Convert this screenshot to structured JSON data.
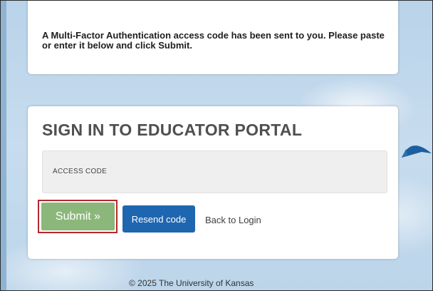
{
  "message": {
    "text_before": "A Multi-Factor Authentication access code has been sent to you. Please paste or enter it below and click ",
    "emphasis": "Submit",
    "text_after": "."
  },
  "signin": {
    "title": "SIGN IN TO EDUCATOR PORTAL",
    "access_code_label": "ACCESS CODE",
    "access_code_value": ""
  },
  "buttons": {
    "submit_label": "Submit »",
    "resend_label": "Resend code",
    "back_label": "Back to Login"
  },
  "footer": {
    "copyright": "© 2025 The University of Kansas"
  },
  "colors": {
    "submit": "#8cb77a",
    "resend": "#1f66b0",
    "highlight": "#b5282e"
  }
}
